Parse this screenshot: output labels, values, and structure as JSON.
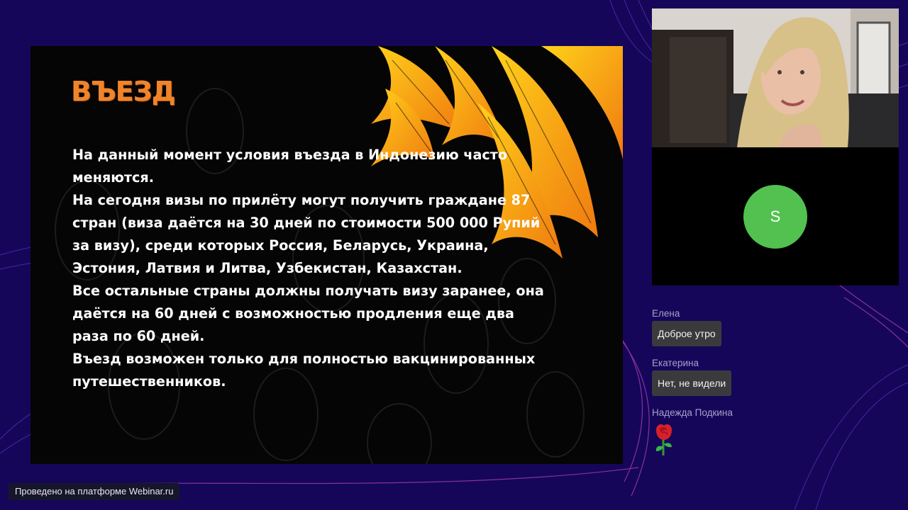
{
  "slide": {
    "title": "въезд",
    "paragraphs": [
      "На данный момент условия въезда в Индонезию часто меняются.",
      "На сегодня визы по прилёту могут получить граждане 87 стран (виза даётся на 30 дней по стоимости 500 000 Рупий за визу), среди которых Россия, Беларусь, Украина, Эстония, Латвия и Литва, Узбекистан, Казахстан.",
      "Все остальные страны должны получать визу заранее, она даётся на 60 дней с возможностью продления еще два раза по 60 дней.",
      "Въезд возможен только для полностью вакцинированных путешественников."
    ]
  },
  "participant_tile": {
    "initial": "S",
    "avatar_color": "#52c14f"
  },
  "chat": {
    "messages": [
      {
        "author": "Елена",
        "text": "Доброе утро"
      },
      {
        "author": "Екатерина",
        "text": "Нет, не видели"
      },
      {
        "author": "Надежда Подкина",
        "emoji": "rose"
      }
    ]
  },
  "footer": {
    "badge": "Проведено на платформе Webinar.ru"
  },
  "colors": {
    "background": "#15065a",
    "title": "#f0842a",
    "chat_bubble": "#3a3a3d"
  }
}
